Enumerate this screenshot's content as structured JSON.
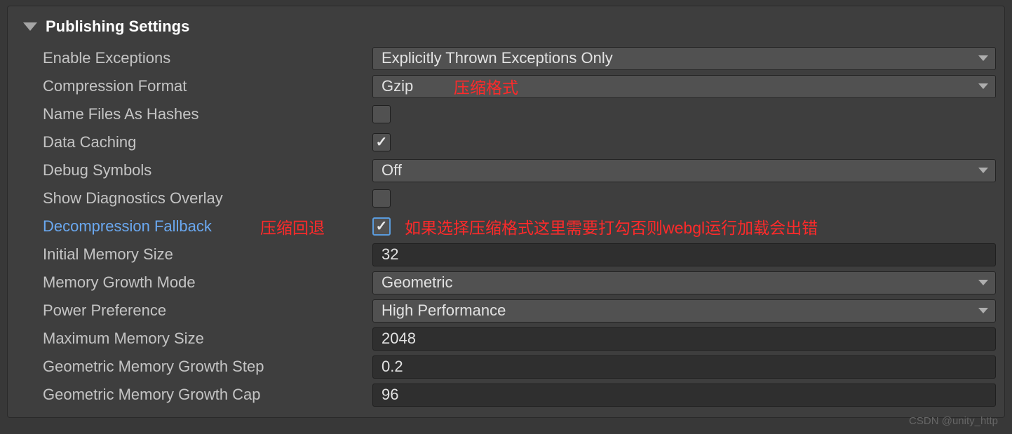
{
  "section": {
    "title": "Publishing Settings"
  },
  "rows": {
    "enable_exceptions": {
      "label": "Enable Exceptions",
      "value": "Explicitly Thrown Exceptions Only"
    },
    "compression_format": {
      "label": "Compression Format",
      "value": "Gzip"
    },
    "name_files_as_hashes": {
      "label": "Name Files As Hashes",
      "checked": false
    },
    "data_caching": {
      "label": "Data Caching",
      "checked": true
    },
    "debug_symbols": {
      "label": "Debug Symbols",
      "value": "Off"
    },
    "show_diagnostics_overlay": {
      "label": "Show Diagnostics Overlay",
      "checked": false
    },
    "decompression_fallback": {
      "label": "Decompression Fallback",
      "checked": true
    },
    "initial_memory_size": {
      "label": "Initial Memory Size",
      "value": "32"
    },
    "memory_growth_mode": {
      "label": "Memory Growth Mode",
      "value": "Geometric"
    },
    "power_preference": {
      "label": "Power Preference",
      "value": "High Performance"
    },
    "maximum_memory_size": {
      "label": "Maximum Memory Size",
      "value": "2048"
    },
    "geometric_memory_growth_step": {
      "label": "Geometric Memory Growth Step",
      "value": "0.2"
    },
    "geometric_memory_growth_cap": {
      "label": "Geometric Memory Growth Cap",
      "value": "96"
    }
  },
  "annotations": {
    "compression_format": "压缩格式",
    "decompression_fallback_label": "压缩回退",
    "decompression_fallback_note": "如果选择压缩格式这里需要打勾否则webgl运行加载会出错"
  },
  "watermark": "CSDN @unity_http",
  "glyphs": {
    "check": "✓"
  }
}
